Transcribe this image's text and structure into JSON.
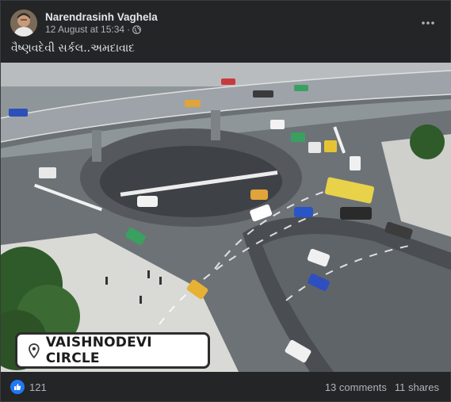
{
  "post": {
    "author": "Narendrasinh Vaghela",
    "timestamp": "12 August at 15:34",
    "separator": "·",
    "privacy_icon": "globe-icon",
    "caption": "વૈષ્ણવદેવી સર્કલ..અમદાવાદ",
    "image_label": "VAISHNODEVI CIRCLE",
    "image_label_icon": "location-pin-icon"
  },
  "stats": {
    "reaction_icon": "like-icon",
    "reaction_count": "121",
    "comments": "13 comments",
    "shares": "11 shares"
  },
  "colors": {
    "background": "#242526",
    "text_primary": "#e4e6eb",
    "text_secondary": "#b0b3b8",
    "like_blue": "#2078f4"
  }
}
